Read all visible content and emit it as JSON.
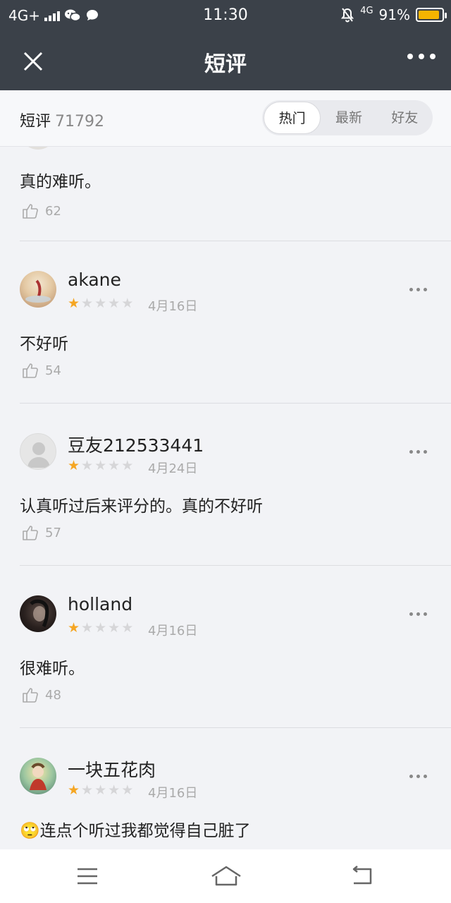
{
  "status_bar": {
    "network": "4G+",
    "time": "11:30",
    "network_right": "4G",
    "battery_percent": "91%",
    "battery_level": 0.91,
    "icons": [
      "signal-icon",
      "wechat-icon",
      "chat-bubble-icon",
      "mute-bell-icon",
      "battery-icon"
    ]
  },
  "nav": {
    "title": "短评",
    "close_icon": "close-icon",
    "more_icon": "more-icon"
  },
  "subheader": {
    "label": "短评",
    "count": "71792",
    "tabs": [
      {
        "label": "热门",
        "active": true
      },
      {
        "label": "最新",
        "active": false
      },
      {
        "label": "好友",
        "active": false
      }
    ]
  },
  "partial_review": {
    "text": "真的难听。",
    "likes": "62"
  },
  "reviews": [
    {
      "username": "akane",
      "rating": 1,
      "date": "4月16日",
      "text": "不好听",
      "likes": "54"
    },
    {
      "username": "豆友212533441",
      "rating": 1,
      "date": "4月24日",
      "text": "认真听过后来评分的。真的不好听",
      "likes": "57"
    },
    {
      "username": "holland",
      "rating": 1,
      "date": "4月16日",
      "text": "很难听。",
      "likes": "48"
    },
    {
      "username": "一块五花肉",
      "rating": 1,
      "date": "4月16日",
      "text": "🙄连点个听过我都觉得自己脏了",
      "likes": ""
    }
  ],
  "colors": {
    "header_bg": "#3b4149",
    "star_on": "#f5a623",
    "star_off": "#d6d6d8",
    "battery": "#f5b400"
  },
  "bottom_nav": {
    "icons": [
      "menu-icon",
      "home-icon",
      "back-icon"
    ]
  }
}
